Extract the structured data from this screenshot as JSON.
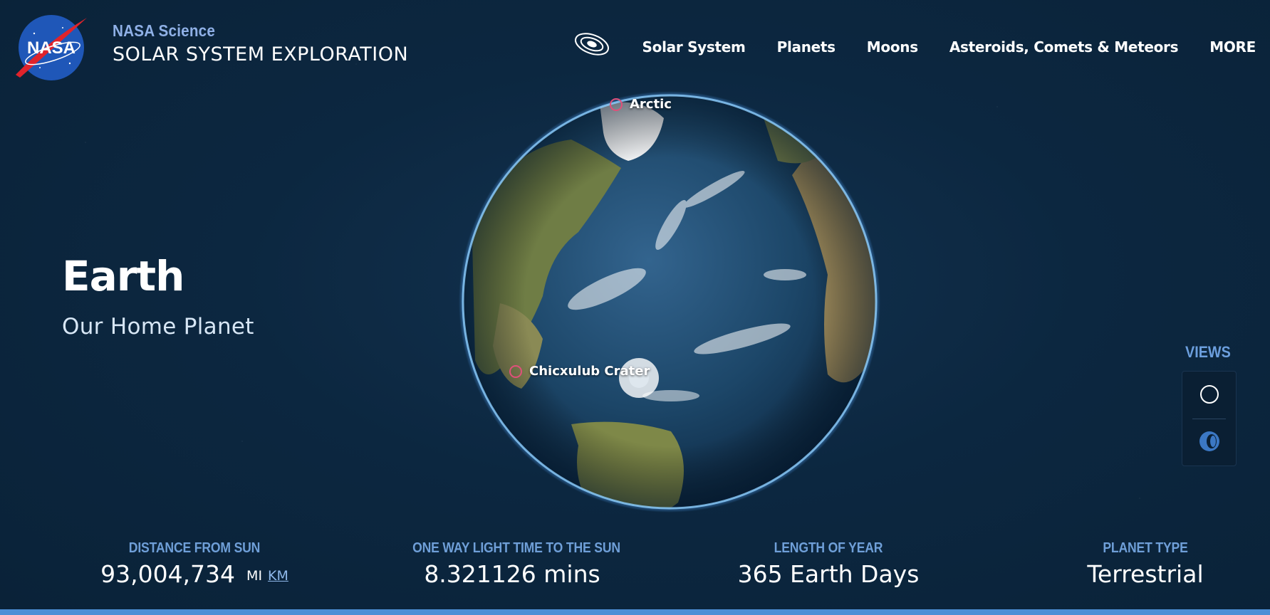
{
  "header": {
    "logo_text": "NASA",
    "site_sub": "NASA Science",
    "site_main": "SOLAR SYSTEM EXPLORATION",
    "orbit_icon": "orbit-icon",
    "nav": [
      "Solar System",
      "Planets",
      "Moons",
      "Asteroids, Comets & Meteors",
      "MORE"
    ]
  },
  "hero": {
    "title": "Earth",
    "tagline": "Our Home Planet"
  },
  "hotspots": [
    {
      "label": "Arctic"
    },
    {
      "label": "Chicxulub Crater"
    }
  ],
  "views": {
    "title": "VIEWS",
    "buttons": [
      "circle-view-icon",
      "side-view-icon"
    ]
  },
  "stats": {
    "distance": {
      "label": "DISTANCE FROM SUN",
      "value": "93,004,734",
      "unit_mi": "MI",
      "unit_km": "KM"
    },
    "light_time": {
      "label": "ONE WAY LIGHT TIME TO THE SUN",
      "value": "8.321126 mins"
    },
    "year": {
      "label": "LENGTH OF YEAR",
      "value": "365 Earth Days"
    },
    "type": {
      "label": "PLANET TYPE",
      "value": "Terrestrial"
    }
  },
  "colors": {
    "background": "#0c2640",
    "accent": "#6f9fd8",
    "hotspot": "#e0507a",
    "atmosphere": "#4fa3ff"
  }
}
